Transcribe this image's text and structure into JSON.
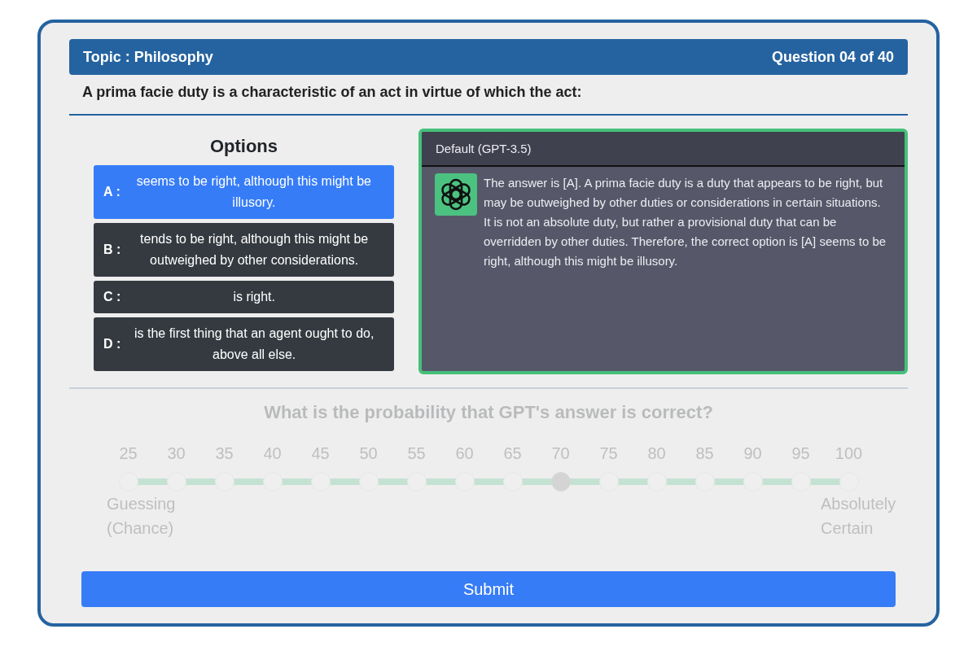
{
  "header": {
    "topic": "Topic : Philosophy",
    "progress": "Question 04 of 40"
  },
  "question": "A prima facie duty is a characteristic of an act in virtue of which the act:",
  "options": {
    "title": "Options",
    "items": [
      {
        "letter": "A :",
        "text": "seems to be right, although this might be illusory.",
        "selected": true
      },
      {
        "letter": "B :",
        "text": "tends to be right, although this might be outweighed by other considerations.",
        "selected": false
      },
      {
        "letter": "C :",
        "text": "is right.",
        "selected": false
      },
      {
        "letter": "D :",
        "text": "is the first thing that an agent ought to do, above all else.",
        "selected": false
      }
    ]
  },
  "answer_panel": {
    "title": "Default (GPT-3.5)",
    "response": "The answer is [A]. A prima facie duty is a duty that appears to be right, but may be outweighed by other duties or considerations in certain situations. It is not an absolute duty, but rather a provisional duty that can be overridden by other duties. Therefore, the correct option is [A] seems to be right, although this might be illusory."
  },
  "probability": {
    "disabled": true,
    "question": "What is the probability that GPT's answer is correct?",
    "stops": [
      {
        "label": "25",
        "selected": false
      },
      {
        "label": "30",
        "selected": false
      },
      {
        "label": "35",
        "selected": false
      },
      {
        "label": "40",
        "selected": false
      },
      {
        "label": "45",
        "selected": false
      },
      {
        "label": "50",
        "selected": false
      },
      {
        "label": "55",
        "selected": false
      },
      {
        "label": "60",
        "selected": false
      },
      {
        "label": "65",
        "selected": false
      },
      {
        "label": "70",
        "selected": true
      },
      {
        "label": "75",
        "selected": false
      },
      {
        "label": "80",
        "selected": false
      },
      {
        "label": "85",
        "selected": false
      },
      {
        "label": "90",
        "selected": false
      },
      {
        "label": "95",
        "selected": false
      },
      {
        "label": "100",
        "selected": false
      }
    ],
    "low_label": "Guessing (Chance)",
    "high_label": "Absolutely Certain"
  },
  "submit": "Submit"
}
